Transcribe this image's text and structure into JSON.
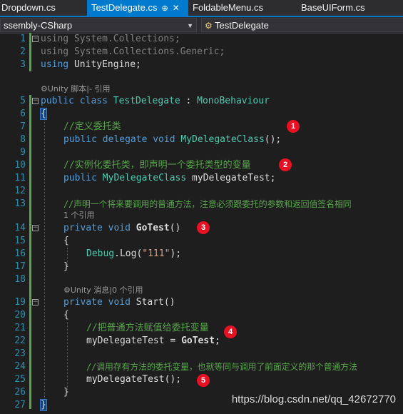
{
  "tabs": [
    {
      "label": "Dropdown.cs"
    },
    {
      "label": "TestDelegate.cs",
      "pin": "⊕",
      "close": "✕"
    },
    {
      "label": "FoldableMenu.cs"
    },
    {
      "label": "BaseUIForm.cs"
    }
  ],
  "nav": {
    "project": "ssembly-CSharp",
    "class_icon": "class-icon",
    "class_name": "TestDelegate"
  },
  "code": {
    "l1": {
      "n": "1",
      "a": "using",
      "b": " System.Collections;"
    },
    "l2": {
      "n": "2",
      "a": "using",
      "b": " System.Collections.Generic;"
    },
    "l3": {
      "n": "3",
      "a": "using",
      "b": " UnityEngine;"
    },
    "lens1": "Unity 脚本|- 引用",
    "l5": {
      "n": "5",
      "kw": "public class ",
      "ty": "TestDelegate",
      "mid": " : ",
      "ty2": "MonoBehaviour"
    },
    "l6": {
      "n": "6",
      "t": "{"
    },
    "l7": {
      "n": "7",
      "t": "//定义委托类"
    },
    "l8": {
      "n": "8",
      "kw": "public delegate void ",
      "ty": "MyDelegateClass",
      "rest": "();"
    },
    "l9": {
      "n": "9"
    },
    "l10": {
      "n": "10",
      "t": "//实例化委托类，即声明一个委托类型的变量"
    },
    "l11": {
      "n": "11",
      "kw": "public ",
      "ty": "MyDelegateClass",
      "rest": " myDelegateTest;"
    },
    "l12": {
      "n": "12"
    },
    "l13": {
      "n": "13",
      "t": "//声明一个将来要调用的普通方法，注意必须跟委托的参数和返回值签名相同"
    },
    "lens2": "1 个引用",
    "l14": {
      "n": "14",
      "kw": "private void ",
      "fn": "GoTest",
      "rest": "()"
    },
    "l15": {
      "n": "15",
      "t": "{"
    },
    "l16": {
      "n": "16",
      "ty": "Debug",
      "a": ".Log(",
      "st": "\"111\"",
      "rest": ");"
    },
    "l17": {
      "n": "17",
      "t": "}"
    },
    "l18": {
      "n": "18"
    },
    "lens3": "Unity 消息|0 个引用",
    "l19": {
      "n": "19",
      "kw": "private void ",
      "a": "Start()"
    },
    "l20": {
      "n": "20",
      "t": "{"
    },
    "l21": {
      "n": "21",
      "t": "//把普通方法赋值给委托变量"
    },
    "l22": {
      "n": "22",
      "a": "myDelegateTest = ",
      "fn": "GoTest",
      "rest": ";"
    },
    "l23": {
      "n": "23"
    },
    "l24": {
      "n": "24",
      "t": "//调用存有方法的委托变量，也就等同与调用了前面定义的那个普通方法"
    },
    "l25": {
      "n": "25",
      "t": "myDelegateTest();"
    },
    "l26": {
      "n": "26",
      "t": "}"
    },
    "l27": {
      "n": "27",
      "t": "}"
    }
  },
  "badges": [
    "1",
    "2",
    "3",
    "4",
    "5"
  ],
  "watermark": "https://blog.csdn.net/qq_42672770",
  "colors": {
    "accent": "#007acc",
    "badge": "#e81123",
    "keyword": "#569cd6",
    "type": "#4ec9b0",
    "comment": "#57a64a",
    "string": "#d69d85",
    "line_number": "#2b91af"
  }
}
